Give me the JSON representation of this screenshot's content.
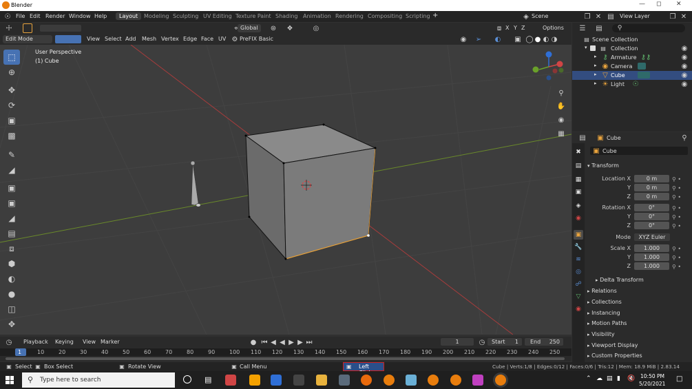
{
  "window": {
    "title": "Blender"
  },
  "menu": [
    "File",
    "Edit",
    "Render",
    "Window",
    "Help"
  ],
  "workspaces": [
    "Layout",
    "Modeling",
    "Sculpting",
    "UV Editing",
    "Texture Paint",
    "Shading",
    "Animation",
    "Rendering",
    "Compositing",
    "Scripting"
  ],
  "active_workspace": "Layout",
  "scene": {
    "label": "Scene",
    "view_layer": "View Layer"
  },
  "viewport_header": {
    "transform_orientation": "Global",
    "mode": "Edit Mode",
    "menus": [
      "View",
      "Select",
      "Add",
      "Mesh",
      "Vertex",
      "Edge",
      "Face",
      "UV"
    ],
    "addon": "PreFIX Basic",
    "options": "Options",
    "axes": [
      "X",
      "Y",
      "Z"
    ]
  },
  "viewport_overlay": {
    "perspective": "User Perspective",
    "object": "(1) Cube"
  },
  "outliner": {
    "root": "Scene Collection",
    "collection": "Collection",
    "items": [
      {
        "name": "Armature",
        "selected": false
      },
      {
        "name": "Camera",
        "selected": false
      },
      {
        "name": "Cube",
        "selected": true
      },
      {
        "name": "Light",
        "selected": false
      }
    ]
  },
  "properties": {
    "object_name": "Cube",
    "data_name": "Cube",
    "transform_label": "Transform",
    "location": {
      "label": "Location X",
      "x": "0 m",
      "y": "0 m",
      "z": "0 m"
    },
    "rotation": {
      "label": "Rotation X",
      "x": "0°",
      "y": "0°",
      "z": "0°"
    },
    "mode_label": "Mode",
    "mode_value": "XYZ Euler",
    "scale": {
      "label": "Scale X",
      "x": "1.000",
      "y": "1.000",
      "z": "1.000"
    },
    "axis_y": "Y",
    "axis_z": "Z",
    "panels": [
      "Delta Transform",
      "Relations",
      "Collections",
      "Instancing",
      "Motion Paths",
      "Visibility",
      "Viewport Display",
      "Custom Properties"
    ]
  },
  "timeline": {
    "menus": [
      "Playback",
      "Keying",
      "View",
      "Marker"
    ],
    "current_frame": "1",
    "start_label": "Start",
    "start": "1",
    "end_label": "End",
    "end": "250",
    "ticks": [
      "1",
      "10",
      "20",
      "30",
      "40",
      "50",
      "60",
      "70",
      "80",
      "90",
      "100",
      "110",
      "120",
      "130",
      "140",
      "150",
      "160",
      "170",
      "180",
      "190",
      "200",
      "210",
      "220",
      "230",
      "240",
      "250"
    ]
  },
  "status_bar": {
    "select": "Select",
    "box_select": "Box Select",
    "rotate_view": "Rotate View",
    "call_menu": "Call Menu",
    "left_click": "Left Click",
    "stats": "Cube | Verts:1/8 | Edges:0/12 | Faces:0/6 | Tris:12 | Mem: 18.9 MiB | 2.83.14 Beta"
  },
  "taskbar": {
    "search_placeholder": "Type here to search",
    "time": "10:50 PM",
    "date": "5/20/2021"
  },
  "colors": {
    "accent": "#4772b3",
    "selection": "#334d80",
    "orange": "#e87d0d"
  }
}
